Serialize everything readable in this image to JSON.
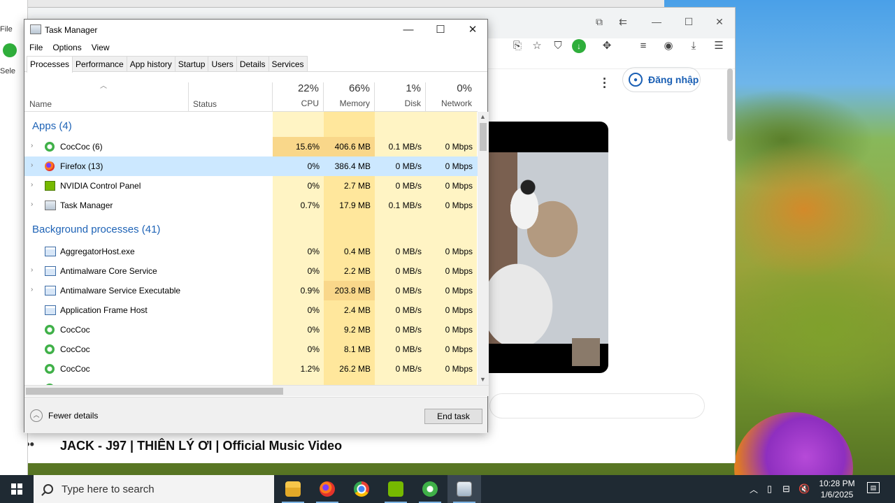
{
  "browser": {
    "login_label": "Đăng nhập",
    "video_title": "JACK - J97 | THIÊN LÝ ƠI | Official Music Video",
    "more_dots": "•••"
  },
  "leftwin": {
    "file_label": "File",
    "sel_label": "Sele"
  },
  "task_manager": {
    "title": "Task Manager",
    "menu": [
      "File",
      "Options",
      "View"
    ],
    "tabs": [
      "Processes",
      "Performance",
      "App history",
      "Startup",
      "Users",
      "Details",
      "Services"
    ],
    "columns": {
      "name": "Name",
      "status": "Status",
      "cpu": {
        "pct": "22%",
        "label": "CPU"
      },
      "memory": {
        "pct": "66%",
        "label": "Memory"
      },
      "disk": {
        "pct": "1%",
        "label": "Disk"
      },
      "network": {
        "pct": "0%",
        "label": "Network"
      }
    },
    "groups": {
      "apps": "Apps (4)",
      "background": "Background processes (41)"
    },
    "apps": [
      {
        "name": "CocCoc (6)",
        "icon": "coccoc-icon",
        "expand": true,
        "cpu": "15.6%",
        "memory": "406.6 MB",
        "disk": "0.1 MB/s",
        "network": "0 Mbps"
      },
      {
        "name": "Firefox (13)",
        "icon": "firefox-icon",
        "expand": true,
        "cpu": "0%",
        "memory": "386.4 MB",
        "disk": "0 MB/s",
        "network": "0 Mbps",
        "selected": true
      },
      {
        "name": "NVIDIA Control Panel",
        "icon": "nvidia-icon",
        "expand": true,
        "cpu": "0%",
        "memory": "2.7 MB",
        "disk": "0 MB/s",
        "network": "0 Mbps"
      },
      {
        "name": "Task Manager",
        "icon": "task-manager-icon",
        "expand": true,
        "cpu": "0.7%",
        "memory": "17.9 MB",
        "disk": "0.1 MB/s",
        "network": "0 Mbps"
      }
    ],
    "background": [
      {
        "name": "AggregatorHost.exe",
        "icon": "window-icon",
        "expand": false,
        "cpu": "0%",
        "memory": "0.4 MB",
        "disk": "0 MB/s",
        "network": "0 Mbps"
      },
      {
        "name": "Antimalware Core Service",
        "icon": "window-icon",
        "expand": true,
        "cpu": "0%",
        "memory": "2.2 MB",
        "disk": "0 MB/s",
        "network": "0 Mbps"
      },
      {
        "name": "Antimalware Service Executable",
        "icon": "window-icon",
        "expand": true,
        "cpu": "0.9%",
        "memory": "203.8 MB",
        "disk": "0 MB/s",
        "network": "0 Mbps"
      },
      {
        "name": "Application Frame Host",
        "icon": "window-icon",
        "expand": false,
        "cpu": "0%",
        "memory": "2.4 MB",
        "disk": "0 MB/s",
        "network": "0 Mbps"
      },
      {
        "name": "CocCoc",
        "icon": "coccoc-icon",
        "expand": false,
        "cpu": "0%",
        "memory": "9.2 MB",
        "disk": "0 MB/s",
        "network": "0 Mbps"
      },
      {
        "name": "CocCoc",
        "icon": "coccoc-icon",
        "expand": false,
        "cpu": "0%",
        "memory": "8.1 MB",
        "disk": "0 MB/s",
        "network": "0 Mbps"
      },
      {
        "name": "CocCoc",
        "icon": "coccoc-icon",
        "expand": false,
        "cpu": "1.2%",
        "memory": "26.2 MB",
        "disk": "0 MB/s",
        "network": "0 Mbps"
      }
    ],
    "fewer_details": "Fewer details",
    "end_task": "End task"
  },
  "taskbar": {
    "search_placeholder": "Type here to search",
    "time": "10:28 PM",
    "date": "1/6/2025"
  },
  "colors": {
    "heat_light": "#fff4c4",
    "heat_mid": "#ffe79c",
    "heat_strong": "#f9d78a",
    "selected_row": "#cce8ff",
    "group_text": "#1e63b6"
  }
}
